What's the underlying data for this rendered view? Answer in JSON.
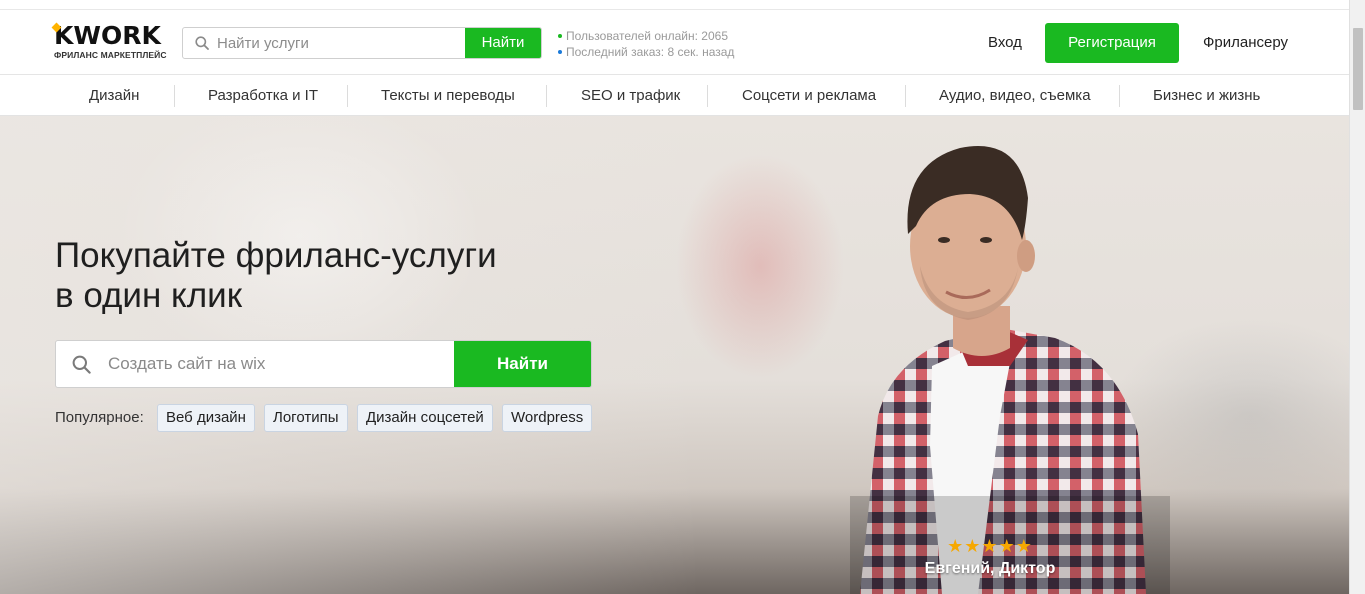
{
  "header": {
    "logo_text": "KWORK",
    "logo_subtitle": "ФРИЛАНС МАРКЕТПЛЕЙС",
    "search_placeholder": "Найти услуги",
    "search_button": "Найти",
    "stats": [
      {
        "text": "Пользователей онлайн: 2065",
        "dot_color": "#1ab921"
      },
      {
        "text": "Последний заказ: 8 сек. назад",
        "dot_color": "#1a7ad9"
      }
    ],
    "login": "Вход",
    "register": "Регистрация",
    "freelancer": "Фрилансеру"
  },
  "categories": [
    "Дизайн",
    "Разработка и IT",
    "Тексты и переводы",
    "SEO и трафик",
    "Соцсети и реклама",
    "Аудио, видео, съемка",
    "Бизнес и жизнь"
  ],
  "hero": {
    "headline_line1": "Покупайте фриланс-услуги",
    "headline_line2": "в один клик",
    "search_placeholder": "Создать сайт на wix",
    "search_button": "Найти",
    "popular_label": "Популярное:",
    "popular_tags": [
      "Веб дизайн",
      "Логотипы",
      "Дизайн соцсетей",
      "Wordpress"
    ],
    "rating_stars": "★★★★★",
    "rating_value": 5,
    "person_name": "Евгений, Диктор"
  },
  "colors": {
    "accent": "#1ab921",
    "star": "#f6a800",
    "chip_bg": "#eef2f7",
    "chip_border": "#c9d4e2"
  },
  "icons": {
    "search": "search-icon"
  }
}
